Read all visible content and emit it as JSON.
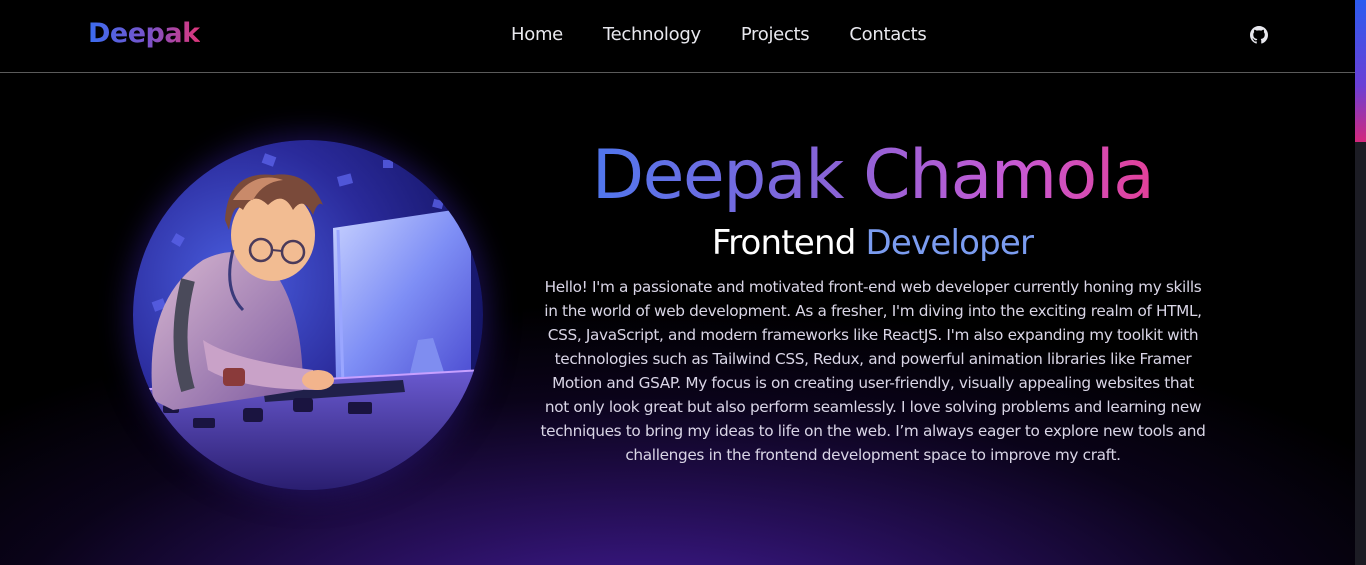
{
  "header": {
    "logo": "Deepak",
    "nav": [
      "Home",
      "Technology",
      "Projects",
      "Contacts"
    ],
    "github_icon": "github-icon"
  },
  "hero": {
    "name": "Deepak Chamola",
    "role_part1": "Frontend",
    "role_part2": "Developer",
    "bio": "Hello! I'm a passionate and motivated front-end web developer currently honing my skills in the world of web development. As a fresher, I'm diving into the exciting realm of HTML, CSS, JavaScript, and modern frameworks like ReactJS. I'm also expanding my toolkit with technologies such as Tailwind CSS, Redux, and powerful animation libraries like Framer Motion and GSAP. My focus is on creating user-friendly, visually appealing websites that not only look great but also perform seamlessly. I love solving problems and learning new techniques to bring my ideas to life on the web. I’m always eager to explore new tools and challenges in the frontend development space to improve my craft."
  },
  "colors": {
    "background": "#000000",
    "accent_blue": "#3f7cf4",
    "accent_pink": "#f0327a",
    "glow_purple": "#4a20aa"
  }
}
